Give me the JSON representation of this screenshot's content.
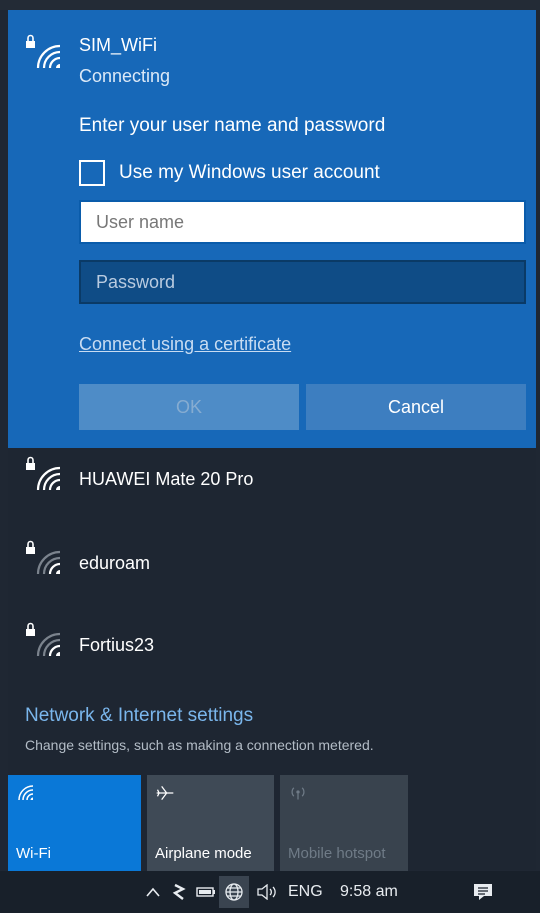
{
  "active_network": {
    "name": "SIM_WiFi",
    "status": "Connecting",
    "prompt": "Enter your user name and password",
    "use_windows_account_label": "Use my Windows user account",
    "username_placeholder": "User name",
    "password_placeholder": "Password",
    "certificate_link": "Connect using a certificate",
    "ok_label": "OK",
    "cancel_label": "Cancel"
  },
  "networks": [
    {
      "name": "HUAWEI Mate 20 Pro",
      "icon": "wifi-secured-icon"
    },
    {
      "name": "eduroam",
      "icon": "wifi-secured-icon"
    },
    {
      "name": "Fortius23",
      "icon": "wifi-secured-icon"
    }
  ],
  "settings": {
    "title": "Network & Internet settings",
    "subtitle": "Change settings, such as making a connection metered."
  },
  "quick_actions": [
    {
      "label": "Wi-Fi",
      "icon": "wifi-icon",
      "state": "on"
    },
    {
      "label": "Airplane mode",
      "icon": "airplane-icon",
      "state": "off"
    },
    {
      "label": "Mobile hotspot",
      "icon": "hotspot-icon",
      "state": "disabled"
    }
  ],
  "taskbar": {
    "language": "ENG",
    "time": "9:58 am"
  },
  "colors": {
    "accent": "#1768b8",
    "flyout_bg": "#1e2632",
    "wifi_tile": "#0a78d7",
    "link": "#7ab6ec"
  }
}
